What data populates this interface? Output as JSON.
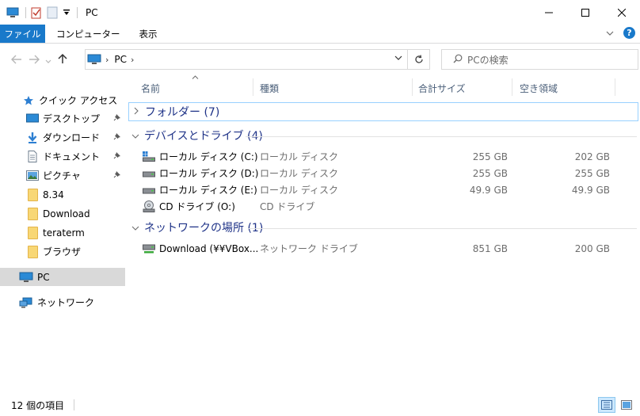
{
  "window": {
    "title": "PC",
    "minimize": "—",
    "maximize": "☐",
    "close": "✕"
  },
  "ribbon": {
    "tabs": [
      "ファイル",
      "コンピューター",
      "表示"
    ],
    "expand": "⌄",
    "help": "?"
  },
  "address": {
    "path": "PC",
    "separator": "›"
  },
  "search": {
    "placeholder": "PCの検索"
  },
  "columns": {
    "name": "名前",
    "type": "種類",
    "total": "合計サイズ",
    "free": "空き領域"
  },
  "sidebar": {
    "quick_access": "クイック アクセス",
    "items": [
      {
        "label": "デスクトップ",
        "icon": "desktop-icon",
        "pinned": true
      },
      {
        "label": "ダウンロード",
        "icon": "download-icon",
        "pinned": true
      },
      {
        "label": "ドキュメント",
        "icon": "document-icon",
        "pinned": true
      },
      {
        "label": "ピクチャ",
        "icon": "pictures-icon",
        "pinned": true
      },
      {
        "label": "8.34",
        "icon": "folder-icon"
      },
      {
        "label": "Download",
        "icon": "folder-icon"
      },
      {
        "label": "teraterm",
        "icon": "folder-icon"
      },
      {
        "label": "ブラウザ",
        "icon": "folder-icon"
      }
    ],
    "pc": "PC",
    "network": "ネットワーク"
  },
  "groups": {
    "folders": "フォルダー (7)",
    "devices": "デバイスとドライブ (4)",
    "network": "ネットワークの場所 (1)"
  },
  "drives": [
    {
      "name": "ローカル ディスク (C:)",
      "type": "ローカル ディスク",
      "total": "255 GB",
      "free": "202 GB",
      "icon": "windows-drive-icon"
    },
    {
      "name": "ローカル ディスク (D:)",
      "type": "ローカル ディスク",
      "total": "255 GB",
      "free": "255 GB",
      "icon": "hard-drive-icon"
    },
    {
      "name": "ローカル ディスク (E:)",
      "type": "ローカル ディスク",
      "total": "49.9 GB",
      "free": "49.9 GB",
      "icon": "hard-drive-icon"
    },
    {
      "name": "CD ドライブ (O:)",
      "type": "CD ドライブ",
      "total": "",
      "free": "",
      "icon": "cd-drive-icon"
    }
  ],
  "network_locations": [
    {
      "name": "Download (¥¥VBox...",
      "type": "ネットワーク ドライブ",
      "total": "851 GB",
      "free": "200 GB",
      "icon": "network-drive-icon"
    }
  ],
  "status": {
    "count": "12 個の項目"
  }
}
